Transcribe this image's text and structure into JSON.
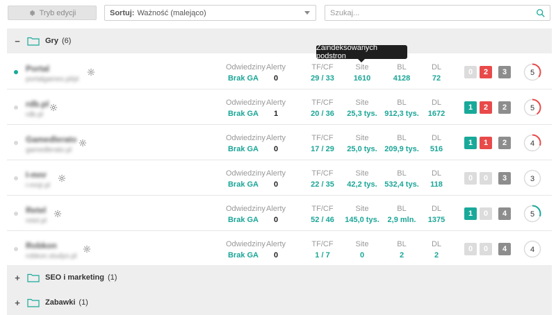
{
  "toolbar": {
    "edit_label": "Tryb edycji",
    "sort_label": "Sortuj:",
    "sort_value": "Ważność (malejąco)",
    "search_placeholder": "Szukaj..."
  },
  "groups": [
    {
      "name": "Gry",
      "count": "(6)",
      "toggle": "−",
      "expanded": true
    },
    {
      "name": "SEO i marketing",
      "count": "(1)",
      "toggle": "+",
      "expanded": false
    },
    {
      "name": "Zabawki",
      "count": "(1)",
      "toggle": "+",
      "expanded": false
    }
  ],
  "tooltip": "Zaindeksowanych podstron",
  "metric_labels": {
    "visits": "Odwiedziny",
    "alerts": "Alerty",
    "tfcf": "TF/CF",
    "site": "Site",
    "bl": "BL",
    "dl": "DL"
  },
  "colors": {
    "teal": "#19a99a",
    "red": "#e84a4a",
    "gray": "#dcdcdc",
    "dark_gray": "#8d8d8d"
  },
  "rows": [
    {
      "name": "Portal",
      "url": "portalgames.pl/pl",
      "active": true,
      "visits": "Brak GA",
      "alerts": "0",
      "tfcf": "29 / 33",
      "site": "1610",
      "bl": "4128",
      "dl": "72",
      "badges": [
        {
          "v": "0",
          "c": "gray"
        },
        {
          "v": "2",
          "c": "red"
        },
        {
          "v": "3",
          "c": "dgray"
        }
      ],
      "score": "5",
      "arc": 0.35,
      "arc_color": "#e84a4a"
    },
    {
      "name": "rdb.pl",
      "url": "rdb.pl",
      "active": false,
      "visits": "Brak GA",
      "alerts": "1",
      "tfcf": "20 / 36",
      "site": "25,3 tys.",
      "bl": "912,3 tys.",
      "dl": "1672",
      "badges": [
        {
          "v": "1",
          "c": "teal"
        },
        {
          "v": "2",
          "c": "red"
        },
        {
          "v": "2",
          "c": "dgray"
        }
      ],
      "score": "5",
      "arc": 0.4,
      "arc_color": "#e84a4a"
    },
    {
      "name": "Gamedlerato",
      "url": "gamedlerato.pl",
      "active": false,
      "visits": "Brak GA",
      "alerts": "0",
      "tfcf": "17 / 29",
      "site": "25,0 tys.",
      "bl": "209,9 tys.",
      "dl": "516",
      "badges": [
        {
          "v": "1",
          "c": "teal"
        },
        {
          "v": "1",
          "c": "red"
        },
        {
          "v": "2",
          "c": "dgray"
        }
      ],
      "score": "4",
      "arc": 0.3,
      "arc_color": "#e84a4a"
    },
    {
      "name": "I-mnr",
      "url": "i-mnjr.pl",
      "active": false,
      "visits": "Brak GA",
      "alerts": "0",
      "tfcf": "22 / 35",
      "site": "42,2 tys.",
      "bl": "532,4 tys.",
      "dl": "118",
      "badges": [
        {
          "v": "0",
          "c": "gray"
        },
        {
          "v": "0",
          "c": "gray"
        },
        {
          "v": "3",
          "c": "dgray"
        }
      ],
      "score": "3",
      "arc": 0,
      "arc_color": "#19a99a"
    },
    {
      "name": "Retel",
      "url": "retel.pl",
      "active": false,
      "visits": "Brak GA",
      "alerts": "0",
      "tfcf": "52 / 46",
      "site": "145,0 tys.",
      "bl": "2,9 mln.",
      "dl": "1375",
      "badges": [
        {
          "v": "1",
          "c": "teal"
        },
        {
          "v": "0",
          "c": "gray"
        },
        {
          "v": "4",
          "c": "dgray"
        }
      ],
      "score": "5",
      "arc": 0.3,
      "arc_color": "#19a99a"
    },
    {
      "name": "Robkon",
      "url": "robkon.studyo.pl",
      "active": false,
      "visits": "Brak GA",
      "alerts": "0",
      "tfcf": "1 / 7",
      "site": "0",
      "bl": "2",
      "dl": "2",
      "badges": [
        {
          "v": "0",
          "c": "gray"
        },
        {
          "v": "0",
          "c": "gray"
        },
        {
          "v": "4",
          "c": "dgray"
        }
      ],
      "score": "4",
      "arc": 0,
      "arc_color": "#19a99a"
    }
  ]
}
